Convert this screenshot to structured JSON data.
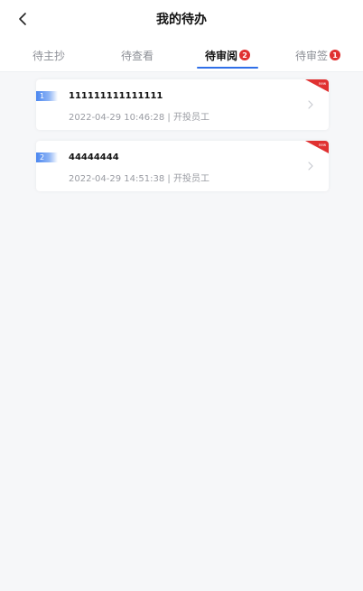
{
  "header": {
    "title": "我的待办",
    "back_icon": "chevron-left-icon"
  },
  "tabs": [
    {
      "label": "待主抄",
      "badge": ""
    },
    {
      "label": "待查看",
      "badge": ""
    },
    {
      "label": "待审阅",
      "badge": "2",
      "active": true
    },
    {
      "label": "待审签",
      "badge": "1"
    }
  ],
  "colors": {
    "accent": "#2f6fe8",
    "badge": "#e03131"
  },
  "items": [
    {
      "index": "1",
      "title": "111111111111111",
      "date": "2022-04-29 10:46:28",
      "separator": "|",
      "author": "开投员工",
      "corner_tag": "new"
    },
    {
      "index": "2",
      "title": "44444444",
      "date": "2022-04-29 14:51:38",
      "separator": "|",
      "author": "开投员工",
      "corner_tag": "new"
    }
  ]
}
